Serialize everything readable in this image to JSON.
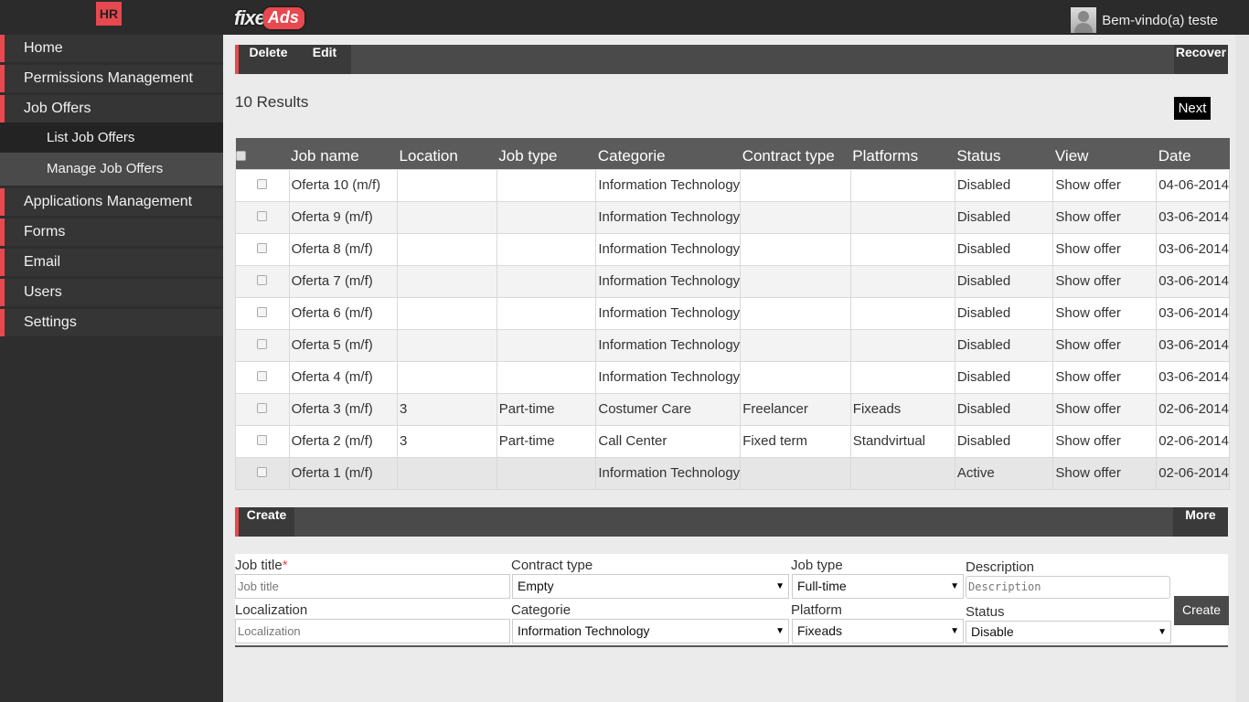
{
  "header": {
    "hr_label": "HR",
    "brand_prefix": "fixe",
    "brand_suffix": "Ads",
    "welcome": "Bem-vindo(a) teste"
  },
  "sidebar": {
    "items": [
      {
        "label": "Home"
      },
      {
        "label": "Permissions Management"
      },
      {
        "label": "Job Offers"
      },
      {
        "label": "List Job Offers"
      },
      {
        "label": "Manage Job Offers"
      },
      {
        "label": "Applications Management"
      },
      {
        "label": "Forms"
      },
      {
        "label": "Email"
      },
      {
        "label": "Users"
      },
      {
        "label": "Settings"
      }
    ]
  },
  "toolbar": {
    "delete": "Delete",
    "edit": "Edit",
    "recover": "Recover"
  },
  "results": {
    "count_text": "10 Results",
    "next": "Next"
  },
  "table": {
    "columns": [
      "Job name",
      "Location",
      "Job type",
      "Categorie",
      "Contract type",
      "Platforms",
      "Status",
      "View",
      "Date"
    ],
    "rows": [
      {
        "name": "Oferta 10 (m/f)",
        "location": "",
        "job_type": "",
        "category": "Information Technology",
        "contract": "",
        "platform": "",
        "status": "Disabled",
        "view": "Show offer",
        "date": "04-06-2014"
      },
      {
        "name": "Oferta 9 (m/f)",
        "location": "",
        "job_type": "",
        "category": "Information Technology",
        "contract": "",
        "platform": "",
        "status": "Disabled",
        "view": "Show offer",
        "date": "03-06-2014"
      },
      {
        "name": "Oferta 8 (m/f)",
        "location": "",
        "job_type": "",
        "category": "Information Technology",
        "contract": "",
        "platform": "",
        "status": "Disabled",
        "view": "Show offer",
        "date": "03-06-2014"
      },
      {
        "name": "Oferta 7 (m/f)",
        "location": "",
        "job_type": "",
        "category": "Information Technology",
        "contract": "",
        "platform": "",
        "status": "Disabled",
        "view": "Show offer",
        "date": "03-06-2014"
      },
      {
        "name": "Oferta 6 (m/f)",
        "location": "",
        "job_type": "",
        "category": "Information Technology",
        "contract": "",
        "platform": "",
        "status": "Disabled",
        "view": "Show offer",
        "date": "03-06-2014"
      },
      {
        "name": "Oferta 5 (m/f)",
        "location": "",
        "job_type": "",
        "category": "Information Technology",
        "contract": "",
        "platform": "",
        "status": "Disabled",
        "view": "Show offer",
        "date": "03-06-2014"
      },
      {
        "name": "Oferta 4 (m/f)",
        "location": "",
        "job_type": "",
        "category": "Information Technology",
        "contract": "",
        "platform": "",
        "status": "Disabled",
        "view": "Show offer",
        "date": "03-06-2014"
      },
      {
        "name": "Oferta 3 (m/f)",
        "location": "3",
        "job_type": "Part-time",
        "category": "Costumer Care",
        "contract": "Freelancer",
        "platform": "Fixeads",
        "status": "Disabled",
        "view": "Show offer",
        "date": "02-06-2014"
      },
      {
        "name": "Oferta 2 (m/f)",
        "location": "3",
        "job_type": "Part-time",
        "category": "Call Center",
        "contract": "Fixed term",
        "platform": "Standvirtual",
        "status": "Disabled",
        "view": "Show offer",
        "date": "02-06-2014"
      },
      {
        "name": "Oferta 1 (m/f)",
        "location": "",
        "job_type": "",
        "category": "Information Technology",
        "contract": "",
        "platform": "",
        "status": "Active",
        "view": "Show offer",
        "date": "02-06-2014"
      }
    ]
  },
  "create_bar": {
    "create": "Create",
    "more": "More"
  },
  "form": {
    "job_title_label": "Job title",
    "required_mark": "*",
    "job_title_placeholder": "Job title",
    "contract_type_label": "Contract type",
    "contract_type_value": "Empty",
    "job_type_label": "Job type",
    "job_type_value": "Full-time",
    "description_label": "Description",
    "description_placeholder": "Description",
    "localization_label": "Localization",
    "localization_placeholder": "Localization",
    "categorie_label": "Categorie",
    "categorie_value": "Information Technology",
    "platform_label": "Platform",
    "platform_value": "Fixeads",
    "status_label": "Status",
    "status_value": "Disable",
    "submit": "Create"
  },
  "colors": {
    "accent": "#e8484f",
    "link": "#1f3fc7"
  }
}
